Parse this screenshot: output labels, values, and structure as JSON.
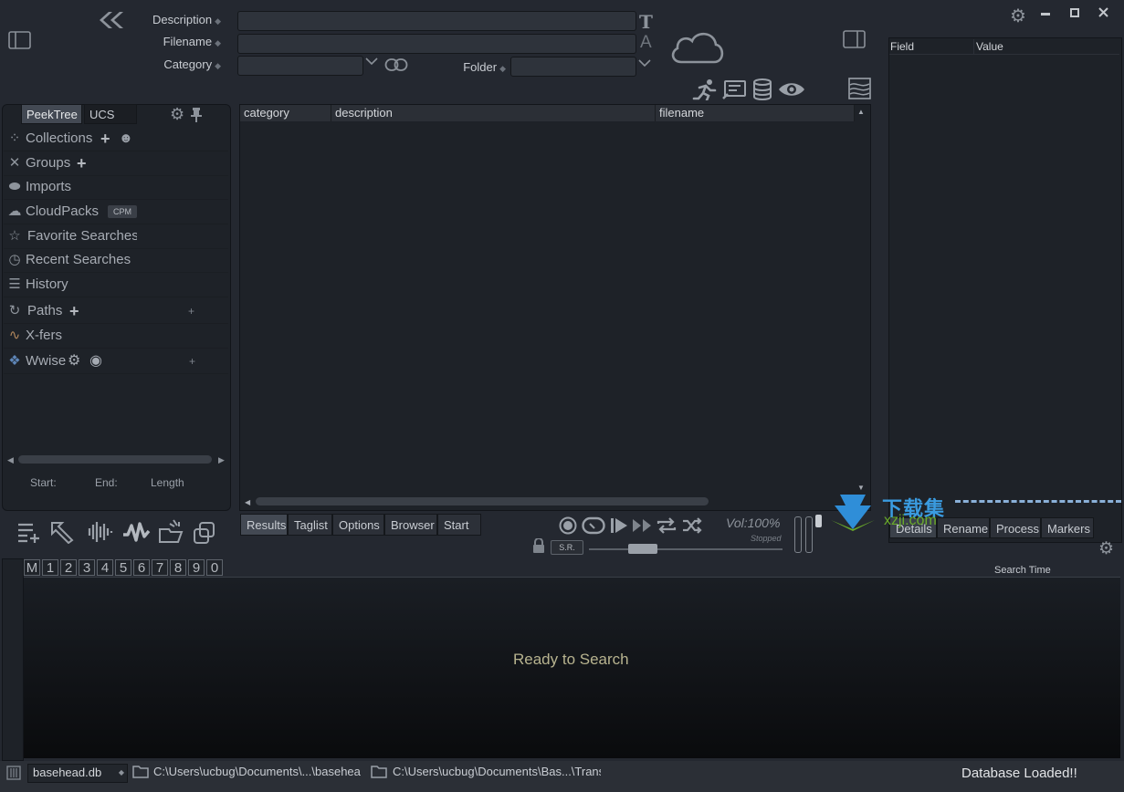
{
  "search": {
    "description_label": "Description",
    "filename_label": "Filename",
    "category_label": "Category",
    "folder_label": "Folder",
    "description_value": "",
    "filename_value": "",
    "category_value": "",
    "folder_value": ""
  },
  "left_panel": {
    "tabs": [
      "PeekTree",
      "UCS"
    ],
    "items": [
      {
        "label": "Collections",
        "icon": "collections-icon"
      },
      {
        "label": "Groups",
        "icon": "groups-icon"
      },
      {
        "label": "Imports",
        "icon": "imports-icon"
      },
      {
        "label": "CloudPacks",
        "icon": "cloud-icon",
        "badge": "CPM"
      },
      {
        "label": "Favorite Searches",
        "icon": "star-icon"
      },
      {
        "label": "Recent Searches",
        "icon": "clock-icon"
      },
      {
        "label": "History",
        "icon": "history-icon"
      },
      {
        "label": "Paths",
        "icon": "path-icon"
      },
      {
        "label": "X-fers",
        "icon": "xfer-icon"
      },
      {
        "label": "Wwise",
        "icon": "wwise-icon"
      }
    ],
    "range": {
      "start_label": "Start:",
      "end_label": "End:",
      "length_label": "Length"
    }
  },
  "results": {
    "columns": [
      "category",
      "description",
      "filename"
    ],
    "rows": []
  },
  "bottom_tabs": [
    "Results",
    "Taglist",
    "Options",
    "Browser",
    "Start"
  ],
  "transport": {
    "volume": "Vol:100%",
    "status": "Stopped",
    "sr_label": "S.R."
  },
  "right_panel": {
    "columns": [
      "Field",
      "Value"
    ],
    "tabs": [
      "Details",
      "Rename",
      "Process",
      "Markers"
    ]
  },
  "marker_digits": [
    "M",
    "1",
    "2",
    "3",
    "4",
    "5",
    "6",
    "7",
    "8",
    "9",
    "0"
  ],
  "waveform": {
    "search_time_label": "Search Time",
    "message": "Ready to Search"
  },
  "status_bar": {
    "db_select": "basehead.db",
    "path1": "C:\\Users\\ucbug\\Documents\\...\\basehea",
    "path2": "C:\\Users\\ucbug\\Documents\\Bas...\\Trans",
    "message": "Database Loaded!!"
  },
  "watermark": {
    "text1": "下载集",
    "text2": "xzji.com"
  },
  "colors": {
    "background": "#242830",
    "panel": "#1e2228",
    "waveform_bg": "#0e1013",
    "message": "#b7b38f"
  }
}
